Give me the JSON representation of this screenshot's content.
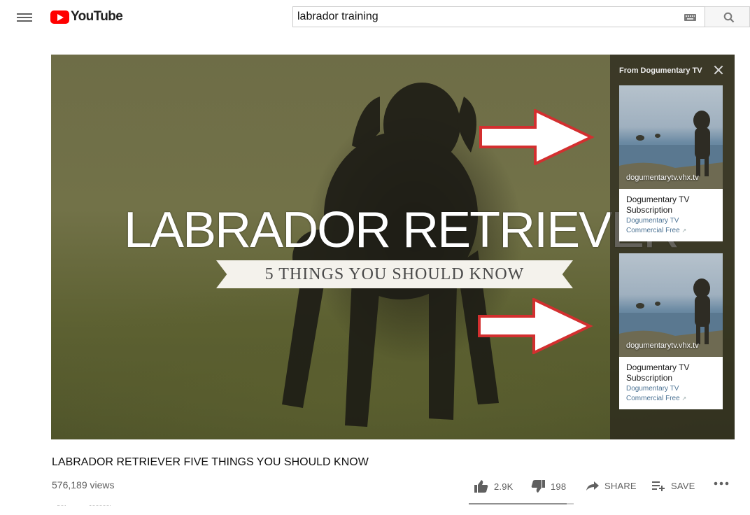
{
  "header": {
    "logo_text": "YouTube",
    "search_value": "labrador training",
    "icons": [
      "menu-icon",
      "youtube-logo-icon",
      "keyboard-icon",
      "search-icon"
    ]
  },
  "player": {
    "overlay_title": "LABRADOR RETRIEVER",
    "overlay_subtitle": "5 THINGS YOU SHOULD KNOW",
    "suggestions": {
      "header": "From Dogumentary TV",
      "cards": [
        {
          "thumb_url": "dogumentarytv.vhx.tv",
          "title": "Dogumentary TV Subscription",
          "channel": "Dogumentary TV",
          "label": "Commercial Free"
        },
        {
          "thumb_url": "dogumentarytv.vhx.tv",
          "title": "Dogumentary TV Subscription",
          "channel": "Dogumentary TV",
          "label": "Commercial Free"
        }
      ]
    },
    "annotation_color": "#d32f2f"
  },
  "video": {
    "title": "LABRADOR RETRIEVER FIVE THINGS YOU SHOULD KNOW",
    "views": "576,189 views",
    "likes": "2.9K",
    "dislikes": "198",
    "share_label": "SHARE",
    "save_label": "SAVE",
    "like_ratio": 0.93
  }
}
